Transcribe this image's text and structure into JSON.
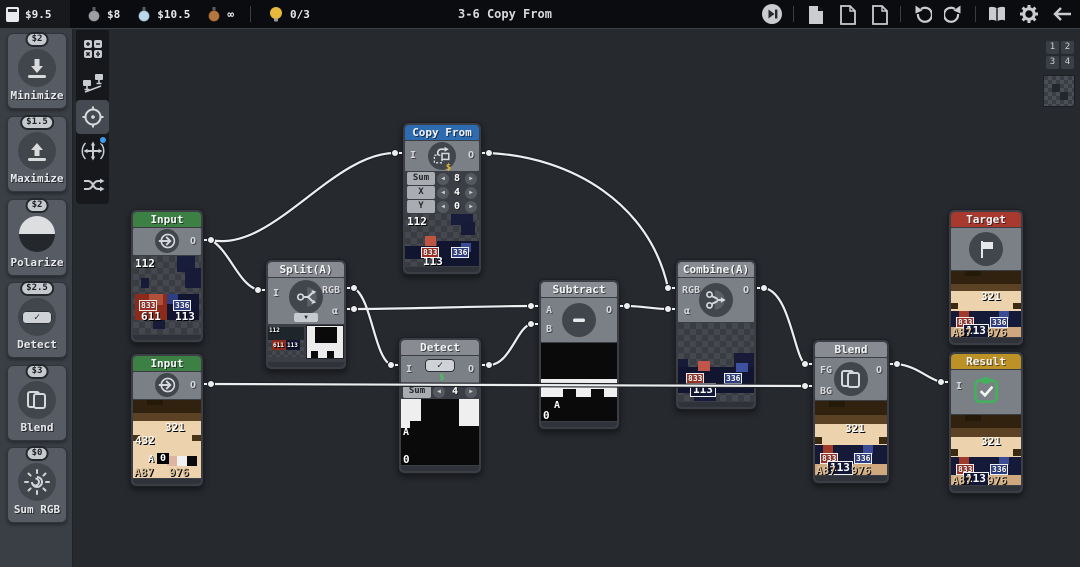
{
  "topbar": {
    "wallet": "$9.5",
    "medals": [
      {
        "name": "silver-medal",
        "value": "$8"
      },
      {
        "name": "sapphire-medal",
        "value": "$10.5"
      },
      {
        "name": "bronze-medal",
        "value": "∞"
      }
    ],
    "hints": "0/3",
    "title": "3-6 Copy From"
  },
  "pager": {
    "cells": [
      "1",
      "2",
      "3",
      "4"
    ]
  },
  "ui": {
    "dec": "◀",
    "inc": "▶",
    "dropdown": "▼",
    "check": "✓",
    "dollar": "$"
  },
  "palette": {
    "items": [
      {
        "price": "$2",
        "label": "Minimize"
      },
      {
        "price": "$1.5",
        "label": "Maximize"
      },
      {
        "price": "$2",
        "label": "Polarize"
      },
      {
        "price": "$2.5",
        "label": "Detect"
      },
      {
        "price": "$3",
        "label": "Blend"
      },
      {
        "price": "$0",
        "label": "Sum RGB"
      }
    ]
  },
  "nodes": {
    "input1": {
      "title": "Input",
      "port_out": "O",
      "labels": {
        "c112": "112",
        "c833": "833",
        "c611": "611",
        "c336": "336",
        "c113": "113"
      }
    },
    "input2": {
      "title": "Input",
      "port_out": "O",
      "labels": {
        "c321": "321",
        "c432": "432",
        "a": "A",
        "zero": "0",
        "a87": "A87",
        "c976": "976"
      }
    },
    "copyfrom": {
      "title": "Copy From",
      "port_in": "I",
      "port_out": "O",
      "params": [
        {
          "name": "Sum",
          "value": "8"
        },
        {
          "name": "X",
          "value": "4"
        },
        {
          "name": "Y",
          "value": "0"
        }
      ],
      "labels": {
        "c112": "112",
        "c833": "833",
        "c336": "336",
        "c113": "113"
      }
    },
    "split": {
      "title": "Split(A)",
      "port_in": "I",
      "port_rgb": "RGB",
      "port_alpha": "α",
      "labels": {
        "c112": "112",
        "c611": "611",
        "c113": "113"
      }
    },
    "detect": {
      "title": "Detect",
      "port_in": "I",
      "port_out": "O",
      "params": [
        {
          "name": "Sum",
          "value": "4"
        }
      ],
      "labels": {
        "a": "A",
        "zero": "0"
      }
    },
    "subtract": {
      "title": "Subtract",
      "port_a": "A",
      "port_b": "B",
      "port_out": "O",
      "labels": {
        "a": "A",
        "zero": "0"
      }
    },
    "combine": {
      "title": "Combine(A)",
      "port_rgb": "RGB",
      "port_alpha": "α",
      "port_out": "O",
      "labels": {
        "c833": "833",
        "c336": "336",
        "c113": "113"
      }
    },
    "blend": {
      "title": "Blend",
      "port_fg": "FG",
      "port_bg": "BG",
      "port_out": "O",
      "labels": {
        "c321": "321",
        "c833": "833",
        "c336": "336",
        "c113": "113",
        "a87": "A87",
        "c976": "976"
      }
    },
    "target": {
      "title": "Target",
      "labels": {
        "c321": "321",
        "c833": "833",
        "c336": "336",
        "c113": "113",
        "a87": "A87",
        "c976": "976"
      }
    },
    "result": {
      "title": "Result",
      "port_in": "I",
      "labels": {
        "c321": "321",
        "c833": "833",
        "c336": "336",
        "c113": "113",
        "a87": "A87",
        "c976": "976"
      }
    }
  }
}
